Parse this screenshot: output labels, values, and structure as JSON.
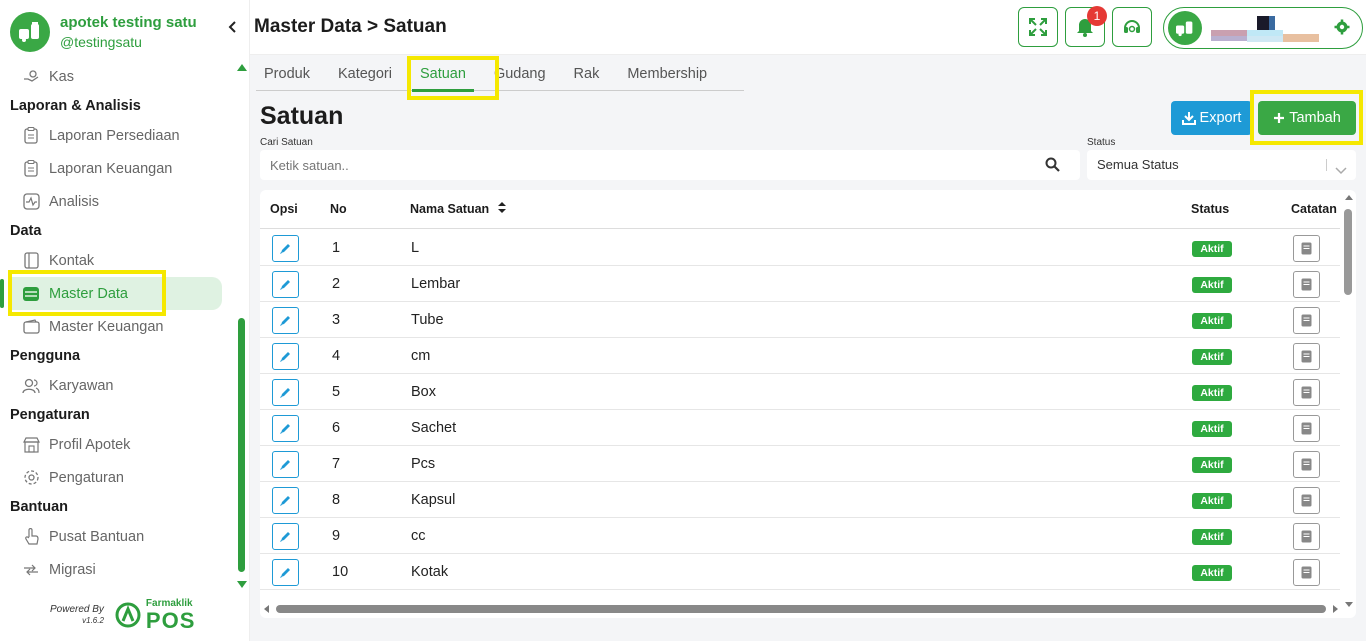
{
  "brand": {
    "name": "apotek testing satu",
    "handle": "@testingsatu"
  },
  "sidebar": {
    "top_item": "Kas",
    "sections": [
      {
        "title": "Laporan & Analisis",
        "items": [
          "Laporan Persediaan",
          "Laporan Keuangan",
          "Analisis"
        ]
      },
      {
        "title": "Data",
        "items": [
          "Kontak",
          "Master Data",
          "Master Keuangan"
        ]
      },
      {
        "title": "Pengguna",
        "items": [
          "Karyawan"
        ]
      },
      {
        "title": "Pengaturan",
        "items": [
          "Profil Apotek",
          "Pengaturan"
        ]
      },
      {
        "title": "Bantuan",
        "items": [
          "Pusat Bantuan",
          "Migrasi"
        ]
      }
    ],
    "active_item": "Master Data",
    "powered_by": "Powered By",
    "version": "v1.6.2",
    "product_small": "Farmaklik",
    "product_big": "POS"
  },
  "header": {
    "title": "Master Data > Satuan",
    "notification_count": "1"
  },
  "tabs": [
    "Produk",
    "Kategori",
    "Satuan",
    "Gudang",
    "Rak",
    "Membership"
  ],
  "active_tab": "Satuan",
  "content": {
    "title": "Satuan",
    "export_label": "Export",
    "add_label": "Tambah",
    "search_label": "Cari Satuan",
    "search_placeholder": "Ketik satuan..",
    "status_label": "Status",
    "status_value": "Semua Status"
  },
  "table": {
    "headers": {
      "opsi": "Opsi",
      "no": "No",
      "nama": "Nama Satuan",
      "status": "Status",
      "catatan": "Catatan"
    },
    "rows": [
      {
        "no": "1",
        "name": "L",
        "status": "Aktif"
      },
      {
        "no": "2",
        "name": "Lembar",
        "status": "Aktif"
      },
      {
        "no": "3",
        "name": "Tube",
        "status": "Aktif"
      },
      {
        "no": "4",
        "name": "cm",
        "status": "Aktif"
      },
      {
        "no": "5",
        "name": "Box",
        "status": "Aktif"
      },
      {
        "no": "6",
        "name": "Sachet",
        "status": "Aktif"
      },
      {
        "no": "7",
        "name": "Pcs",
        "status": "Aktif"
      },
      {
        "no": "8",
        "name": "Kapsul",
        "status": "Aktif"
      },
      {
        "no": "9",
        "name": "cc",
        "status": "Aktif"
      },
      {
        "no": "10",
        "name": "Kotak",
        "status": "Aktif"
      }
    ]
  },
  "colors": {
    "primary_green": "#2e9e3e",
    "export_blue": "#1e9ad6",
    "highlight_yellow": "#f5e800",
    "danger": "#e53935"
  }
}
